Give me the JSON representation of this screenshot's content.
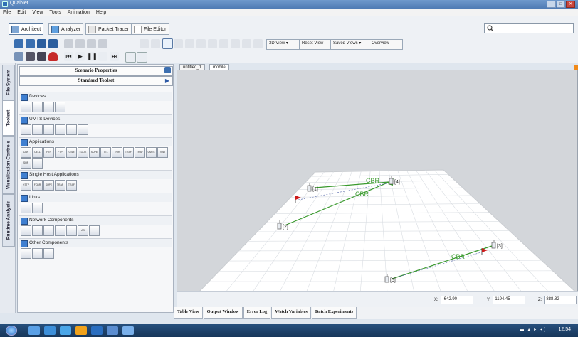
{
  "window": {
    "title": "QualNet"
  },
  "menu": [
    "File",
    "Edit",
    "View",
    "Tools",
    "Animation",
    "Help"
  ],
  "modes": [
    {
      "label": "Architect",
      "active": true
    },
    {
      "label": "Analyzer",
      "active": false
    },
    {
      "label": "Packet Tracer",
      "active": false
    },
    {
      "label": "File Editor",
      "active": false
    }
  ],
  "toolbar": {
    "view3d": "3D View",
    "reset": "Reset View",
    "saved": "Saved Views",
    "overview": "Overview"
  },
  "side_tabs": [
    "File System",
    "Toolset",
    "Visualization Controls",
    "Runtime Analysis"
  ],
  "panel": {
    "scenario": "Scenario Properties",
    "toolset": "Standard Toolset",
    "sections": [
      {
        "label": "Devices",
        "icons": [
          "",
          "",
          "",
          ""
        ]
      },
      {
        "label": "UMTS Devices",
        "icons": [
          "",
          "",
          "",
          "",
          "",
          ""
        ]
      },
      {
        "label": "Applications",
        "icons": [
          "CBR",
          "CELL ULAR",
          "FTP",
          "FTP GEN",
          "GSM",
          "LOOK UP",
          "SUPE APP",
          "TEL NET",
          "THIR ADD",
          "TRAF GEN",
          "TRAF TRC",
          "UMTS",
          "VBR",
          "SHP",
          ""
        ]
      },
      {
        "label": "Single Host Applications",
        "icons": [
          "HTTP",
          "FCBR",
          "SUPE APP",
          "TRAF GEN",
          "TRAF TRC"
        ]
      },
      {
        "label": "Links",
        "icons": [
          "",
          ""
        ]
      },
      {
        "label": "Network Components",
        "icons": [
          "",
          "",
          "",
          "",
          "",
          "AS",
          ""
        ]
      },
      {
        "label": "Other Components",
        "icons": [
          "",
          "",
          ""
        ]
      }
    ]
  },
  "doc_tabs": [
    {
      "label": "untitled_1",
      "active": false
    },
    {
      "label": "mobile",
      "active": true
    }
  ],
  "scene": {
    "nodes": [
      {
        "label": "[1]"
      },
      {
        "label": "[2]"
      },
      {
        "label": "[3]"
      },
      {
        "label": "[4]"
      },
      {
        "label": "[5]"
      }
    ],
    "links": [
      {
        "label": "CBR"
      },
      {
        "label": "CBR"
      },
      {
        "label": "CBR"
      }
    ]
  },
  "coords": {
    "x_label": "X:",
    "x": "-642.90",
    "y_label": "Y:",
    "y": "1194.45",
    "z_label": "Z:",
    "z": "888.82"
  },
  "bottom_tabs": [
    "Table View",
    "Output Window",
    "Error Log",
    "Watch Variables",
    "Batch Experiments"
  ],
  "taskbar": {
    "clock": "12:54"
  },
  "colors": {
    "link": "#3a9a2e",
    "flag": "#cc1a1a",
    "titlebar": "#5a86bf"
  }
}
